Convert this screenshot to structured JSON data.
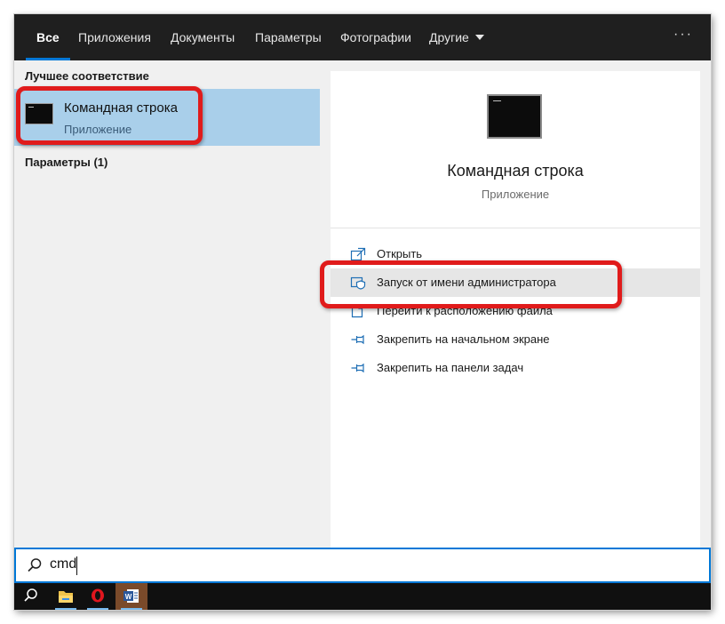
{
  "tabs": [
    {
      "label": "Все",
      "active": true
    },
    {
      "label": "Приложения"
    },
    {
      "label": "Документы"
    },
    {
      "label": "Параметры"
    },
    {
      "label": "Фотографии"
    },
    {
      "label": "Другие"
    }
  ],
  "more_menu": "···",
  "left_panel": {
    "best_match_heading": "Лучшее соответствие",
    "best_match": {
      "title": "Командная строка",
      "subtitle": "Приложение",
      "icon": "cmd-icon"
    },
    "settings_heading": "Параметры (1)"
  },
  "right_panel": {
    "app_title": "Командная строка",
    "app_subtitle": "Приложение",
    "actions": [
      {
        "label": "Открыть",
        "icon": "open-icon"
      },
      {
        "label": "Запуск от имени администратора",
        "icon": "admin-shield-icon"
      },
      {
        "label": "Перейти к расположению файла",
        "icon": "file-location-icon"
      },
      {
        "label": "Закрепить на начальном экране",
        "icon": "pin-icon"
      },
      {
        "label": "Закрепить на панели задач",
        "icon": "pin-icon"
      }
    ]
  },
  "search": {
    "value": "cmd",
    "icon": "search-icon"
  },
  "taskbar": {
    "items": [
      "search-icon",
      "file-explorer-icon",
      "opera-icon",
      "word-icon"
    ]
  },
  "colors": {
    "accent": "#0078d7",
    "selection": "#a9cfea",
    "annotation_red": "#e01b1b",
    "topbar": "#1f1f1f"
  }
}
